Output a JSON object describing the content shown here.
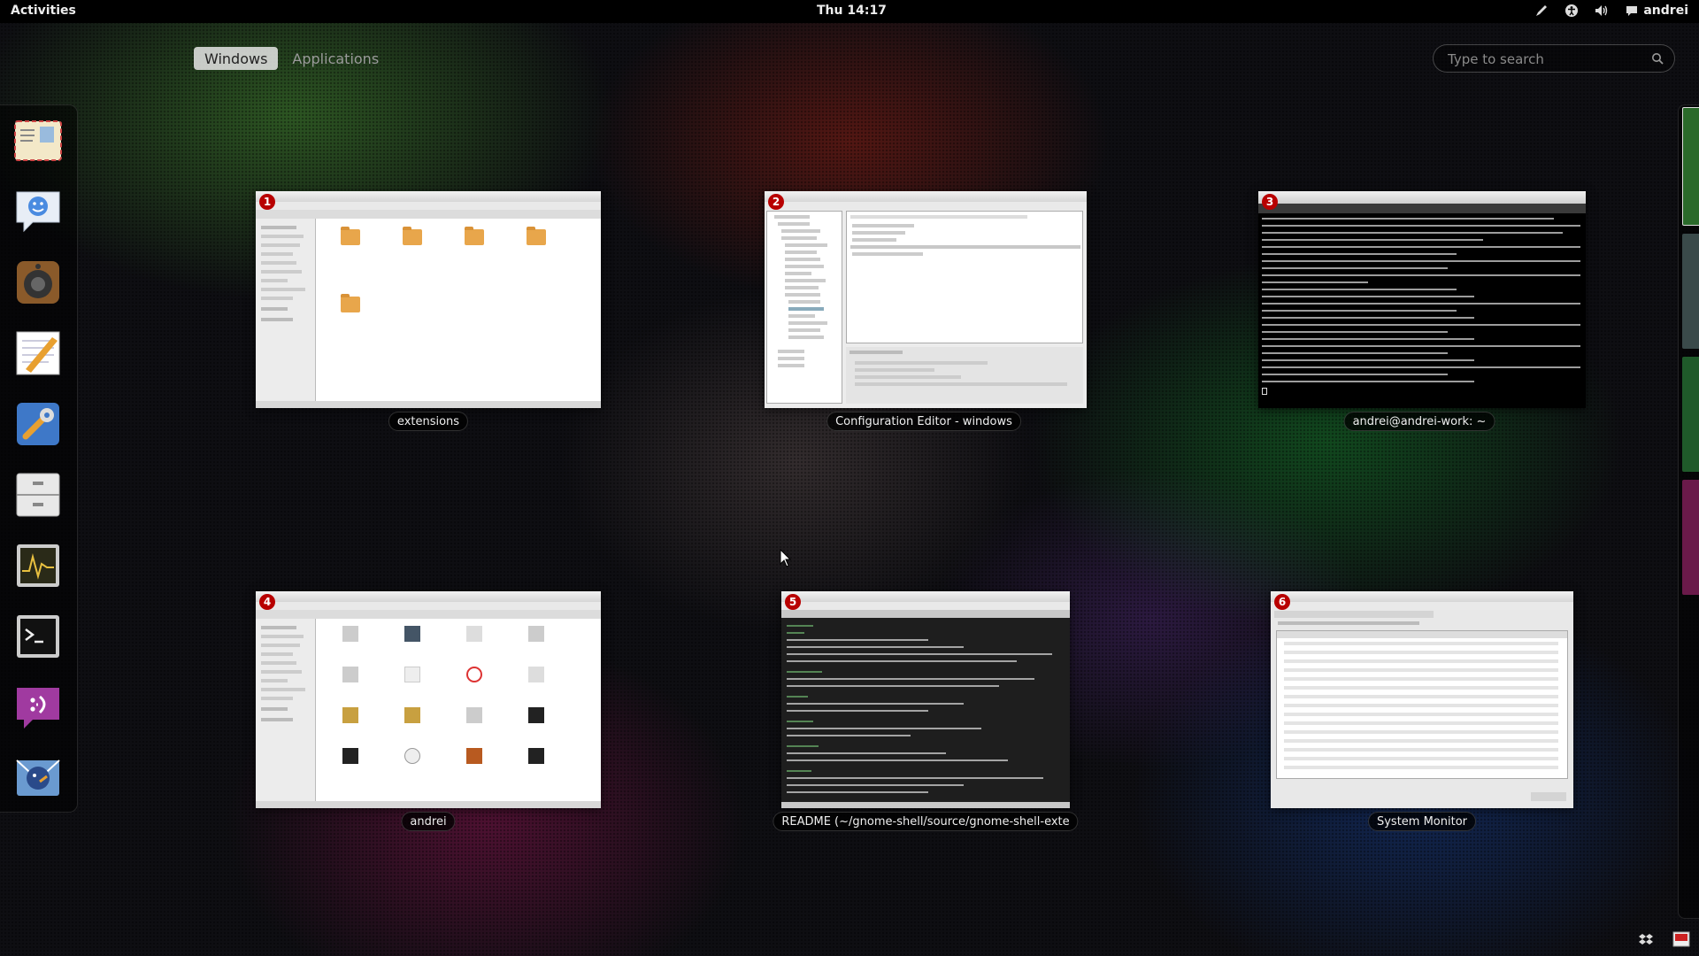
{
  "topbar": {
    "activities": "Activities",
    "clock": "Thu 14:17",
    "user": "andrei",
    "status_icons": [
      "pen-icon",
      "accessibility-icon",
      "volume-icon",
      "chat-icon"
    ]
  },
  "view_selector": {
    "tabs": [
      {
        "label": "Windows",
        "active": true
      },
      {
        "label": "Applications",
        "active": false
      }
    ]
  },
  "search": {
    "placeholder": "Type to search"
  },
  "dash": {
    "items": [
      {
        "name": "mail-app",
        "icon": "envelope-icon"
      },
      {
        "name": "empathy-chat",
        "icon": "chat-bubble-icon"
      },
      {
        "name": "rhythmbox",
        "icon": "speaker-icon"
      },
      {
        "name": "gedit",
        "icon": "notepad-pencil-icon"
      },
      {
        "name": "system-settings",
        "icon": "wrench-icon"
      },
      {
        "name": "file-manager",
        "icon": "file-cabinet-icon"
      },
      {
        "name": "system-monitor",
        "icon": "monitor-graph-icon"
      },
      {
        "name": "terminal",
        "icon": "terminal-icon"
      },
      {
        "name": "pidgin",
        "icon": "smiley-icon"
      },
      {
        "name": "thunderbird",
        "icon": "thunderbird-icon"
      }
    ]
  },
  "windows": [
    {
      "number": "1",
      "caption": "extensions",
      "kind": "file-manager"
    },
    {
      "number": "2",
      "caption": "Configuration Editor - windows",
      "kind": "config-editor"
    },
    {
      "number": "3",
      "caption": "andrei@andrei-work: ~",
      "kind": "terminal"
    },
    {
      "number": "4",
      "caption": "andrei",
      "kind": "file-manager"
    },
    {
      "number": "5",
      "caption": "README (~/gnome-shell/source/gnome-shell-exte",
      "kind": "text-editor"
    },
    {
      "number": "6",
      "caption": "System Monitor",
      "kind": "system-monitor"
    }
  ],
  "colors": {
    "topbar": "#000000",
    "badge": "#b80000",
    "active_tab": "#e6e6e6"
  }
}
